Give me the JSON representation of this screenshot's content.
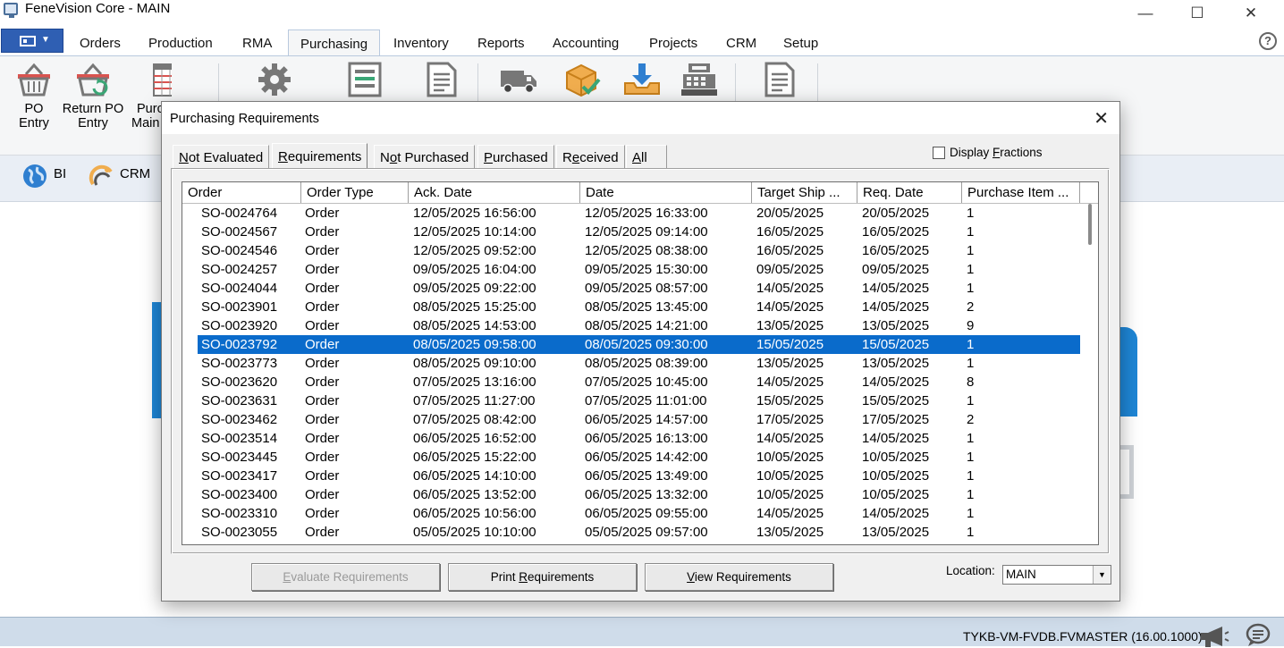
{
  "window": {
    "title": "FeneVision Core - MAIN",
    "minimize": "—",
    "maximize": "☐",
    "close": "✕"
  },
  "ribbon": {
    "tabs": [
      "Orders",
      "Production",
      "RMA",
      "Purchasing",
      "Inventory",
      "Reports",
      "Accounting",
      "Projects",
      "CRM",
      "Setup"
    ],
    "active_tab": "Purchasing",
    "help": "?",
    "buttons": [
      {
        "label_line1": "PO",
        "label_line2": "Entry"
      },
      {
        "label_line1": "Return PO",
        "label_line2": "Entry"
      },
      {
        "label_line1": "Purc",
        "label_line2": "Main"
      }
    ],
    "lower": {
      "bi": "BI",
      "crm": "CRM"
    }
  },
  "dialog": {
    "title": "Purchasing Requirements",
    "tabs": [
      {
        "pre": "",
        "u": "N",
        "post": "ot Evaluated"
      },
      {
        "pre": "",
        "u": "R",
        "post": "equirements"
      },
      {
        "pre": "N",
        "u": "o",
        "post": "t Purchased"
      },
      {
        "pre": "",
        "u": "P",
        "post": "urchased"
      },
      {
        "pre": "R",
        "u": "e",
        "post": "ceived"
      },
      {
        "pre": "",
        "u": "A",
        "post": "ll"
      }
    ],
    "active_tab": 1,
    "display_fractions": {
      "pre": "Display ",
      "u": "F",
      "post": "ractions",
      "checked": false
    },
    "columns": [
      "Order",
      "Order Type",
      "Ack. Date",
      "Date",
      "Target Ship ...",
      "Req. Date",
      "Purchase Item ..."
    ],
    "rows": [
      [
        "SO-0024764",
        "Order",
        "12/05/2025 16:56:00",
        "12/05/2025 16:33:00",
        "20/05/2025",
        "20/05/2025",
        "1"
      ],
      [
        "SO-0024567",
        "Order",
        "12/05/2025 10:14:00",
        "12/05/2025 09:14:00",
        "16/05/2025",
        "16/05/2025",
        "1"
      ],
      [
        "SO-0024546",
        "Order",
        "12/05/2025 09:52:00",
        "12/05/2025 08:38:00",
        "16/05/2025",
        "16/05/2025",
        "1"
      ],
      [
        "SO-0024257",
        "Order",
        "09/05/2025 16:04:00",
        "09/05/2025 15:30:00",
        "09/05/2025",
        "09/05/2025",
        "1"
      ],
      [
        "SO-0024044",
        "Order",
        "09/05/2025 09:22:00",
        "09/05/2025 08:57:00",
        "14/05/2025",
        "14/05/2025",
        "1"
      ],
      [
        "SO-0023901",
        "Order",
        "08/05/2025 15:25:00",
        "08/05/2025 13:45:00",
        "14/05/2025",
        "14/05/2025",
        "2"
      ],
      [
        "SO-0023920",
        "Order",
        "08/05/2025 14:53:00",
        "08/05/2025 14:21:00",
        "13/05/2025",
        "13/05/2025",
        "9"
      ],
      [
        "SO-0023792",
        "Order",
        "08/05/2025 09:58:00",
        "08/05/2025 09:30:00",
        "15/05/2025",
        "15/05/2025",
        "1"
      ],
      [
        "SO-0023773",
        "Order",
        "08/05/2025 09:10:00",
        "08/05/2025 08:39:00",
        "13/05/2025",
        "13/05/2025",
        "1"
      ],
      [
        "SO-0023620",
        "Order",
        "07/05/2025 13:16:00",
        "07/05/2025 10:45:00",
        "14/05/2025",
        "14/05/2025",
        "8"
      ],
      [
        "SO-0023631",
        "Order",
        "07/05/2025 11:27:00",
        "07/05/2025 11:01:00",
        "15/05/2025",
        "15/05/2025",
        "1"
      ],
      [
        "SO-0023462",
        "Order",
        "07/05/2025 08:42:00",
        "06/05/2025 14:57:00",
        "17/05/2025",
        "17/05/2025",
        "2"
      ],
      [
        "SO-0023514",
        "Order",
        "06/05/2025 16:52:00",
        "06/05/2025 16:13:00",
        "14/05/2025",
        "14/05/2025",
        "1"
      ],
      [
        "SO-0023445",
        "Order",
        "06/05/2025 15:22:00",
        "06/05/2025 14:42:00",
        "10/05/2025",
        "10/05/2025",
        "1"
      ],
      [
        "SO-0023417",
        "Order",
        "06/05/2025 14:10:00",
        "06/05/2025 13:49:00",
        "10/05/2025",
        "10/05/2025",
        "1"
      ],
      [
        "SO-0023400",
        "Order",
        "06/05/2025 13:52:00",
        "06/05/2025 13:32:00",
        "10/05/2025",
        "10/05/2025",
        "1"
      ],
      [
        "SO-0023310",
        "Order",
        "06/05/2025 10:56:00",
        "06/05/2025 09:55:00",
        "14/05/2025",
        "14/05/2025",
        "1"
      ],
      [
        "SO-0023055",
        "Order",
        "05/05/2025 10:10:00",
        "05/05/2025 09:57:00",
        "13/05/2025",
        "13/05/2025",
        "1"
      ]
    ],
    "selected_row": 7,
    "buttons": {
      "evaluate": {
        "pre": "",
        "u": "E",
        "post": "valuate Requirements",
        "enabled": false
      },
      "print": {
        "pre": "Print ",
        "u": "R",
        "post": "equirements",
        "enabled": true
      },
      "view": {
        "pre": "",
        "u": "V",
        "post": "iew Requirements",
        "enabled": true
      }
    },
    "location": {
      "label": "Location:",
      "value": "MAIN"
    }
  },
  "status": {
    "text": "TYKB-VM-FVDB.FVMASTER (16.00.1000)"
  },
  "colors": {
    "accent": "#2f5fb3",
    "selection": "#0a6bcb",
    "status_bar": "#cfdcea",
    "logo_blue": "#1e86d6"
  }
}
